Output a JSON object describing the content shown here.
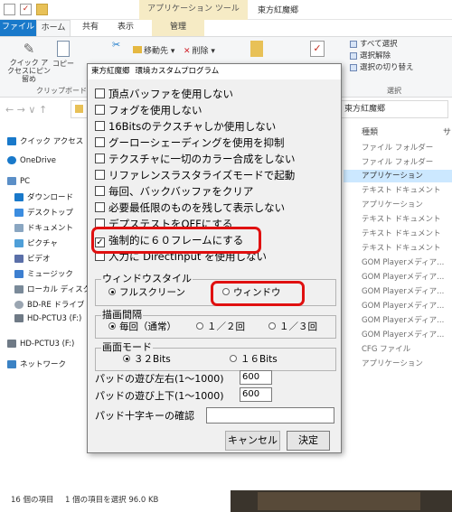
{
  "explorer": {
    "window_title": "東方紅魔郷",
    "contextual_tab": "アプリケーション ツール",
    "tabs": {
      "file": "ファイル",
      "home": "ホーム",
      "share": "共有",
      "view": "表示",
      "manage": "管理"
    },
    "ribbon": {
      "pin_label": "クイック アクセスにピン留め",
      "copy_label": "コピー",
      "paste_label": "貼り付け",
      "clipboard_group": "クリップボード",
      "move_label": "移動先",
      "delete_label": "削除",
      "select_all": "すべて選択",
      "select_none": "選択解除",
      "invert_selection": "選択の切り替え",
      "select_group": "選択"
    },
    "search_text": "東方紅魔郷",
    "nav": [
      {
        "label": "クイック アクセス",
        "icon": "star-icon",
        "color": "#1979ca"
      },
      {
        "label": "OneDrive",
        "icon": "cloud-icon",
        "color": "#1979ca"
      },
      {
        "label": "PC",
        "icon": "computer-icon",
        "color": "#5b8fc7"
      },
      {
        "label": "ダウンロード",
        "icon": "download-icon",
        "color": "#1979ca"
      },
      {
        "label": "デスクトップ",
        "icon": "desktop-icon",
        "color": "#3c8de0"
      },
      {
        "label": "ドキュメント",
        "icon": "document-icon",
        "color": "#8aa6c1"
      },
      {
        "label": "ピクチャ",
        "icon": "picture-icon",
        "color": "#4f9fd8"
      },
      {
        "label": "ビデオ",
        "icon": "video-icon",
        "color": "#5a6fa8"
      },
      {
        "label": "ミュージック",
        "icon": "music-icon",
        "color": "#3d7fd0"
      },
      {
        "label": "ローカル ディスク (C",
        "icon": "disk-icon",
        "color": "#7a8a99"
      },
      {
        "label": "BD-RE ドライブ (E",
        "icon": "disc-icon",
        "color": "#9aa5b1"
      },
      {
        "label": "HD-PCTU3 (F:)",
        "icon": "drive-icon",
        "color": "#6f7a86"
      },
      {
        "label": "HD-PCTU3 (F:)",
        "icon": "drive-icon",
        "color": "#6f7a86"
      },
      {
        "label": "ネットワーク",
        "icon": "network-icon",
        "color": "#3b82c4"
      }
    ],
    "file_header": "種類",
    "file_header2": "サ",
    "files": [
      "ファイル フォルダー",
      "ファイル フォルダー",
      "アプリケーション",
      "テキスト ドキュメント",
      "アプリケーション",
      "テキスト ドキュメント",
      "テキスト ドキュメント",
      "テキスト ドキュメント",
      "GOM Playerメディア...",
      "GOM Playerメディア...",
      "GOM Playerメディア...",
      "GOM Playerメディア...",
      "GOM Playerメディア...",
      "GOM Playerメディア...",
      "CFG ファイル",
      "アプリケーション"
    ],
    "selected_file_index": 2,
    "status_count": "16 個の項目",
    "status_selection": "1 個の項目を選択  96.0 KB"
  },
  "dialog": {
    "title_game": "東方紅魔郷",
    "title_app": "環境カスタムプログラム",
    "checkboxes": [
      {
        "label": "頂点バッファを使用しない",
        "checked": false
      },
      {
        "label": "フォグを使用しない",
        "checked": false
      },
      {
        "label": "16Bitsのテクスチャしか使用しない",
        "checked": false
      },
      {
        "label": "グーローシェーディングを使用を抑制",
        "checked": false
      },
      {
        "label": "テクスチャに一切のカラー合成をしない",
        "checked": false
      },
      {
        "label": "リファレンスラスタライズモードで起動",
        "checked": false
      },
      {
        "label": "毎回、バックバッファをクリア",
        "checked": false
      },
      {
        "label": "必要最低限のものを残して表示しない",
        "checked": false
      },
      {
        "label": "デプステストをOFFにする",
        "checked": false
      },
      {
        "label": "強制的に６０フレームにする",
        "checked": true
      },
      {
        "label": "入力に DirectInput を使用しない",
        "checked": false
      }
    ],
    "window_style": {
      "label": "ウィンドウスタイル",
      "options": [
        "フルスクリーン",
        "ウィンドウ"
      ],
      "selected": "フルスクリーン"
    },
    "draw_interval": {
      "label": "描画間隔",
      "options": [
        "毎回（通常）",
        "１／２回",
        "１／３回"
      ],
      "selected": "毎回（通常）"
    },
    "color_mode": {
      "label": "画面モード",
      "options": [
        "３２Bits",
        "１６Bits"
      ],
      "selected": "３２Bits"
    },
    "pad_lr_label": "パッドの遊び左右(1〜1000)",
    "pad_lr_value": "600",
    "pad_ud_label": "パッドの遊び上下(1〜1000)",
    "pad_ud_value": "600",
    "pad_cross_label": "パッド十字キーの確認",
    "pad_cross_value": "",
    "cancel_label": "キャンセル",
    "ok_label": "決定"
  },
  "highlight_color": "#e01010"
}
